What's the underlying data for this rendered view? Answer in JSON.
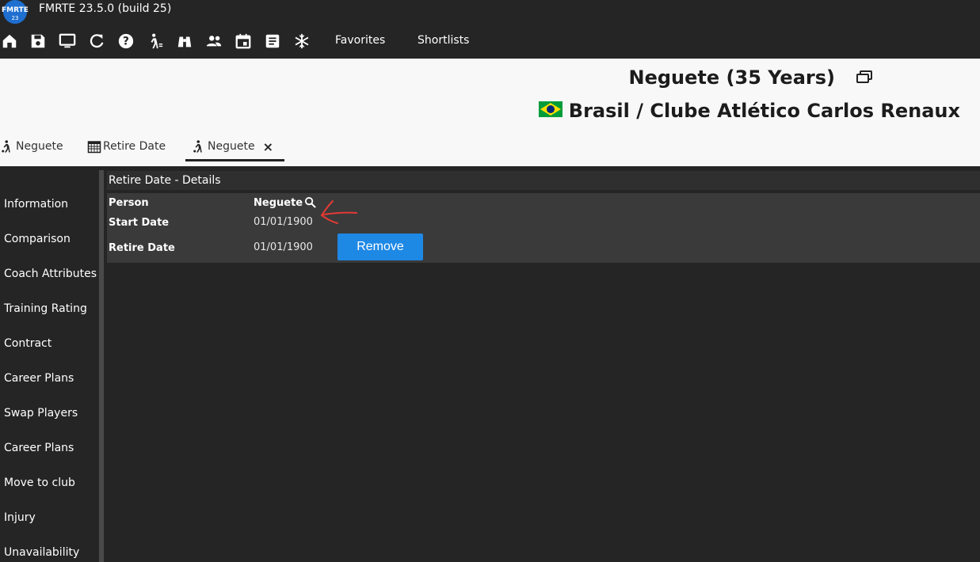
{
  "app": {
    "title": "FMRTE 23.5.0 (build 25)",
    "logo_text": "FMRTE",
    "logo_sub": "23"
  },
  "toolbar": {
    "icons": [
      "home-icon",
      "save-icon",
      "monitor-icon",
      "refresh-icon",
      "help-icon",
      "person-walk-icon",
      "binoculars-icon",
      "people-icon",
      "calendar-icon",
      "document-icon",
      "snowflake-icon"
    ],
    "favorites_label": "Favorites",
    "shortlists_label": "Shortlists"
  },
  "header": {
    "player_title": "Neguete (35 Years)",
    "club_line": "Brasil / Clube Atlético Carlos Renaux",
    "flag_colors": {
      "green": "#009c3b",
      "yellow": "#ffdf00",
      "blue": "#002776"
    }
  },
  "tabs": [
    {
      "label": "Neguete"
    },
    {
      "label": "Retire Date"
    },
    {
      "label": "Neguete",
      "close": "×"
    }
  ],
  "sidebar": {
    "items": [
      "Information",
      "Comparison",
      "Coach Attributes",
      "Training Rating",
      "Contract",
      "Career Plans",
      "Swap Players",
      "Career Plans",
      "Move to club",
      "Injury",
      "Unavailability"
    ]
  },
  "panel": {
    "header": "Retire Date - Details",
    "person_label": "Person",
    "person_value": "Neguete",
    "start_label": "Start Date",
    "start_value": "01/01/1900",
    "retire_label": "Retire Date",
    "retire_value": "01/01/1900",
    "remove_label": "Remove"
  },
  "colors": {
    "accent": "#1e88e5",
    "annotation": "#e53935"
  }
}
